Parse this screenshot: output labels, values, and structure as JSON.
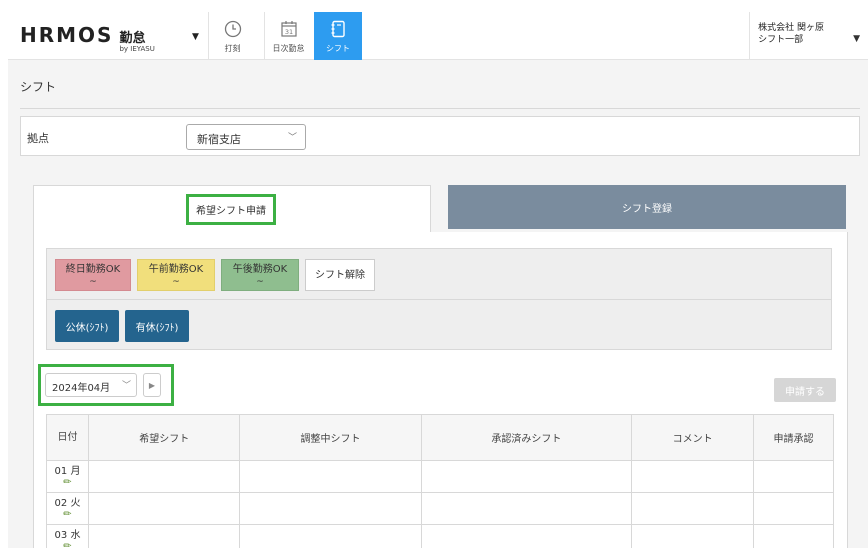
{
  "header": {
    "logo_main": "HRMOS",
    "logo_kintai": "勤怠",
    "logo_by": "by IEYASU",
    "nav": [
      {
        "label": "打刻",
        "icon": "clock-icon"
      },
      {
        "label": "日次勤怠",
        "icon": "calendar-icon",
        "day": "31"
      },
      {
        "label": "シフト",
        "icon": "notebook-icon"
      }
    ],
    "company_line1": "株式会社 関ヶ原",
    "company_line2": "シフト一部"
  },
  "page": {
    "title": "シフト",
    "location_label": "拠点",
    "location_value": "新宿支店"
  },
  "tabs": {
    "active": "希望シフト申請",
    "inactive": "シフト登録"
  },
  "legend": {
    "allday": "終日勤務OK",
    "am": "午前勤務OK",
    "pm": "午後勤務OK",
    "tilde": "~",
    "clear": "シフト解除"
  },
  "holidays": {
    "public": "公休(ｼﾌﾄ)",
    "paid": "有休(ｼﾌﾄ)"
  },
  "month": {
    "value": "2024年04月"
  },
  "apply_button": "申請する",
  "table": {
    "headers": [
      "日付",
      "希望シフト",
      "調整中シフト",
      "承認済みシフト",
      "コメント",
      "申請承認"
    ],
    "rows": [
      {
        "date": "01 月"
      },
      {
        "date": "02 火"
      },
      {
        "date": "03 水"
      }
    ]
  },
  "colors": {
    "nav_active": "#2d9cf0",
    "allday": "#e09aa0",
    "am": "#f1df7c",
    "pm": "#8fbe8f",
    "holiday_btn": "#24648e",
    "tab_inactive": "#7a8c9e",
    "highlight": "#3cb043"
  }
}
